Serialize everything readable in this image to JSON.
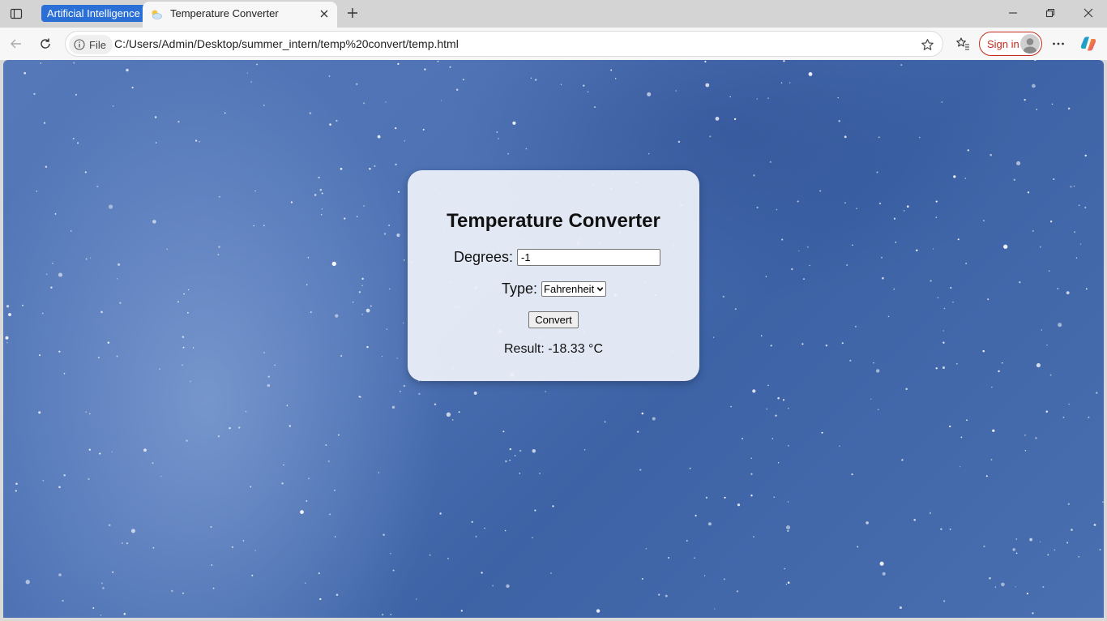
{
  "browser": {
    "tab_group_label": "Artificial Intelligence",
    "active_tab": {
      "title": "Temperature Converter",
      "favicon": "weather-icon"
    },
    "site_chip_label": "File",
    "url": "C:/Users/Admin/Desktop/summer_intern/temp%20convert/temp.html",
    "signin_label": "Sign in",
    "colors": {
      "tab_group": "#2a6fd6",
      "signin": "#c42b1c"
    }
  },
  "page": {
    "title": "Temperature Converter",
    "degrees_label": "Degrees:",
    "degrees_value": "-1",
    "type_label": "Type:",
    "type_selected": "Fahrenheit",
    "convert_label": "Convert",
    "result_text": "Result: -18.33 °C"
  }
}
